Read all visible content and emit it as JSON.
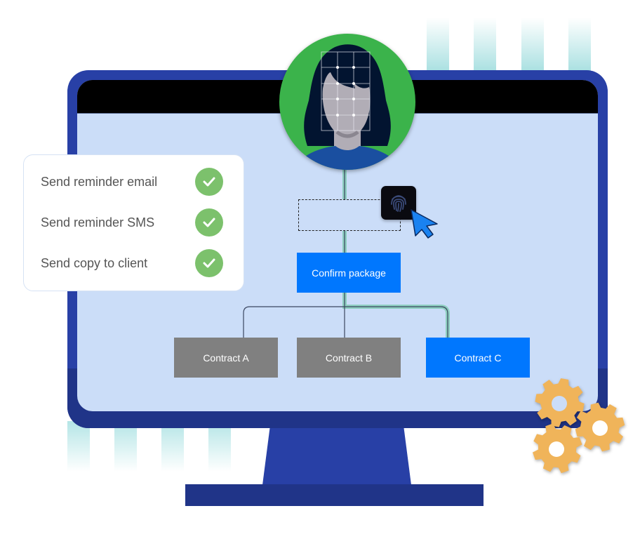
{
  "checklist": {
    "items": [
      {
        "label": "Send reminder email",
        "status": "done",
        "icon": "check-icon"
      },
      {
        "label": "Send reminder SMS",
        "status": "done",
        "icon": "check-icon"
      },
      {
        "label": "Send copy to client",
        "status": "done",
        "icon": "check-icon"
      }
    ]
  },
  "avatar": {
    "icon": "face-scan-icon"
  },
  "flow": {
    "auth_step": {
      "icon": "fingerprint-icon",
      "cursor": "cursor-arrow-icon"
    },
    "confirm": {
      "label": "Confirm package",
      "state": "selected"
    },
    "contracts": [
      {
        "label": "Contract A",
        "state": "inactive"
      },
      {
        "label": "Contract B",
        "state": "inactive"
      },
      {
        "label": "Contract C",
        "state": "selected"
      }
    ]
  },
  "decor": {
    "gears_icon": "gears-icon"
  },
  "colors": {
    "bezel": "#2840a6",
    "screen": "#cbddf8",
    "accent_blue": "#0077fe",
    "inactive_gray": "#808080",
    "success_green": "#7cc16c",
    "avatar_green": "#3bb34b",
    "path_teal": "#8ecfc0",
    "gear_orange": "#f0b45a"
  }
}
